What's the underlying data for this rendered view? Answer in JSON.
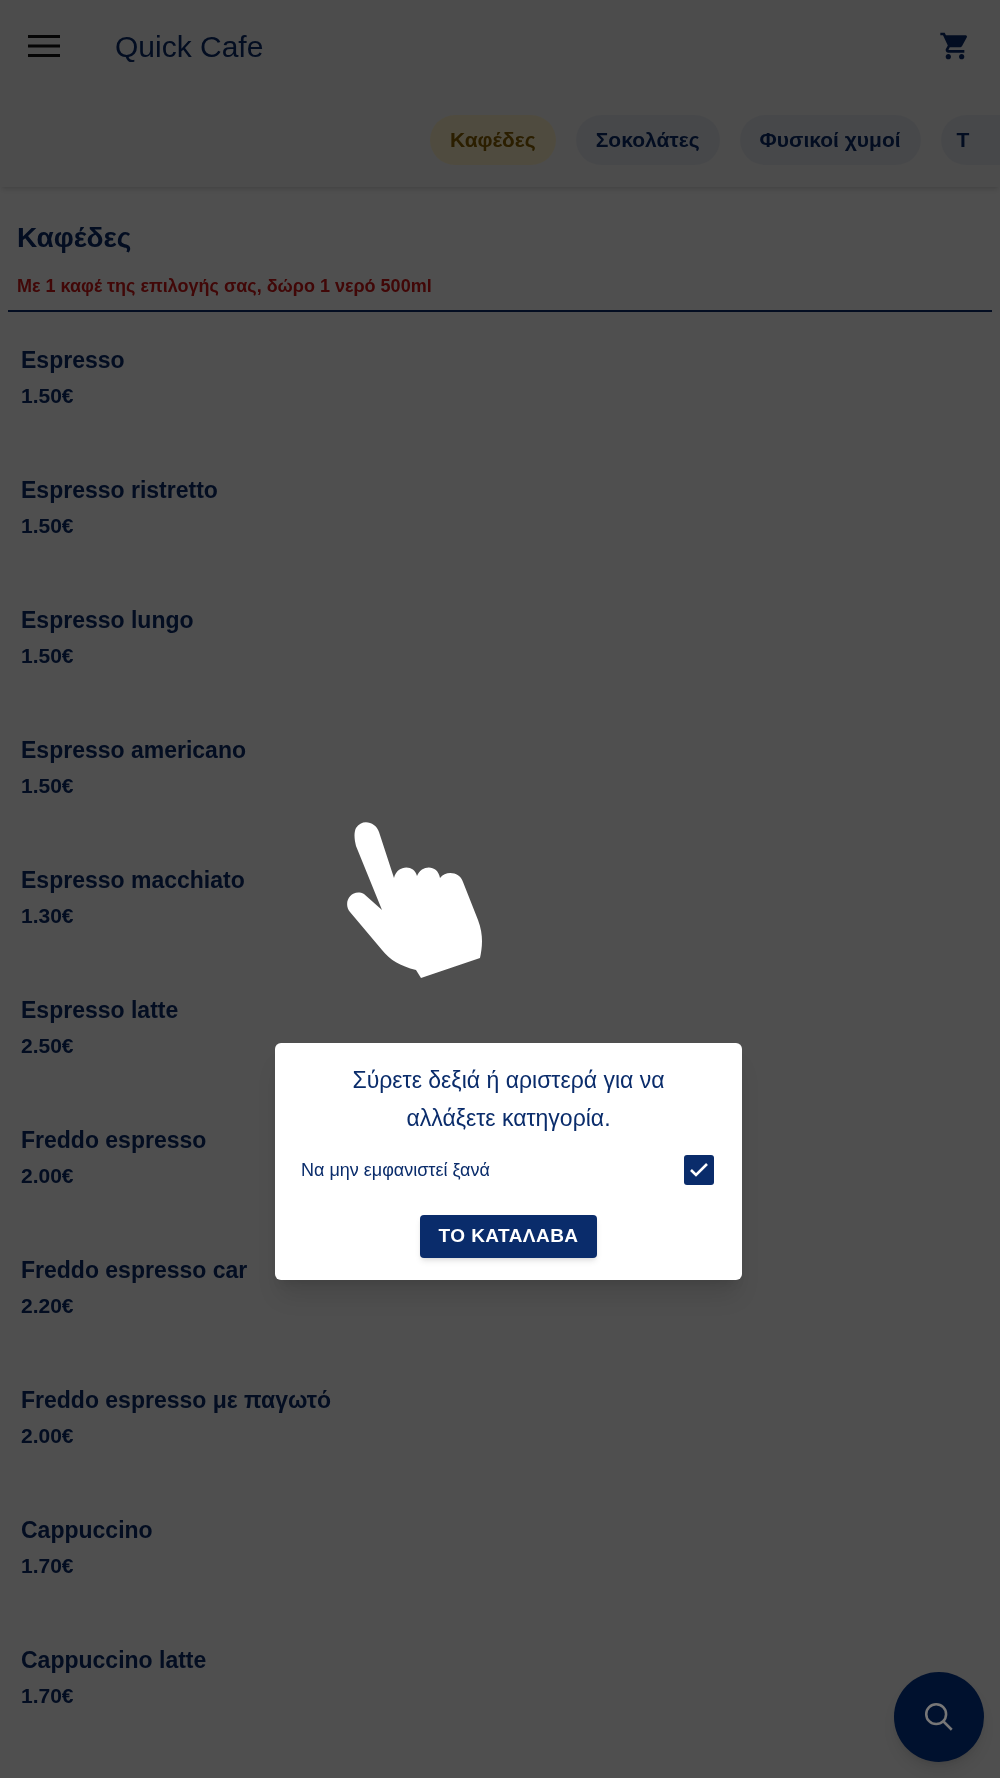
{
  "app_bar": {
    "title": "Quick Cafe"
  },
  "tabs": [
    {
      "label": "Καφέδες",
      "selected": true
    },
    {
      "label": "Σοκολάτες",
      "selected": false
    },
    {
      "label": "Φυσικοί χυμοί",
      "selected": false
    },
    {
      "label": "Τ",
      "selected": false
    }
  ],
  "category": {
    "title": "Καφέδες",
    "note": "Με 1 καφέ της επιλογής σας, δώρο 1 νερό 500ml"
  },
  "items": [
    {
      "name": "Espresso",
      "price": "1.50€"
    },
    {
      "name": "Espresso ristretto",
      "price": "1.50€"
    },
    {
      "name": "Espresso lungo",
      "price": "1.50€"
    },
    {
      "name": "Espresso americano",
      "price": "1.50€"
    },
    {
      "name": "Espresso macchiato",
      "price": "1.30€"
    },
    {
      "name": "Espresso latte",
      "price": "2.50€"
    },
    {
      "name": "Freddo espresso",
      "price": "2.00€"
    },
    {
      "name": "Freddo espresso car",
      "price": "2.20€"
    },
    {
      "name": "Freddo espresso με παγωτό",
      "price": "2.00€"
    },
    {
      "name": "Cappuccino",
      "price": "1.70€"
    },
    {
      "name": "Cappuccino latte",
      "price": "1.70€"
    }
  ],
  "dialog": {
    "message": "Σύρετε δεξιά ή αριστερά για να αλλάξετε κατηγορία.",
    "checkbox": {
      "label": "Να μην εμφανιστεί ξανά",
      "checked": true
    },
    "button": "ΤΟ ΚΑΤΑΛΑΒΑ"
  }
}
